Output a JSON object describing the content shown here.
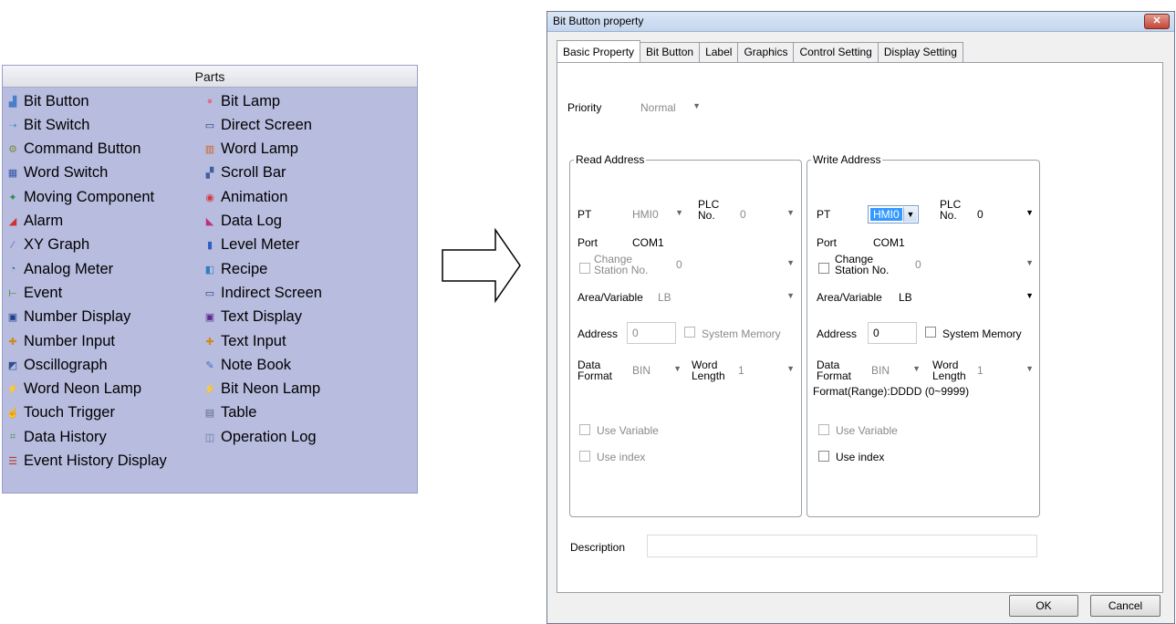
{
  "parts": {
    "header": "Parts",
    "left_items": [
      {
        "label": "Bit Button",
        "icon": "bit-button-icon",
        "glyph": "▟",
        "color": "#4a7fc8"
      },
      {
        "label": "Bit Switch",
        "icon": "bit-switch-icon",
        "glyph": "➝",
        "color": "#3f8fd0"
      },
      {
        "label": "Command Button",
        "icon": "command-button-icon",
        "glyph": "⚙",
        "color": "#7a8a3a"
      },
      {
        "label": "Word Switch",
        "icon": "word-switch-icon",
        "glyph": "▦",
        "color": "#3355aa"
      },
      {
        "label": "Moving Component",
        "icon": "moving-component-icon",
        "glyph": "✦",
        "color": "#2e8b57"
      },
      {
        "label": "Alarm",
        "icon": "alarm-icon",
        "glyph": "◢",
        "color": "#d03030"
      },
      {
        "label": "XY Graph",
        "icon": "xy-graph-icon",
        "glyph": "⁄",
        "color": "#6a5acd"
      },
      {
        "label": "Analog Meter",
        "icon": "analog-meter-icon",
        "glyph": "◔",
        "color": "#2f6fa8"
      },
      {
        "label": "Event",
        "icon": "event-icon",
        "glyph": "⊢",
        "color": "#2a8a2a"
      },
      {
        "label": "Number Display",
        "icon": "number-display-icon",
        "glyph": "▣",
        "color": "#1f3f8f"
      },
      {
        "label": "Number Input",
        "icon": "number-input-icon",
        "glyph": "✚",
        "color": "#d08a1a"
      },
      {
        "label": "Oscillograph",
        "icon": "oscillograph-icon",
        "glyph": "◩",
        "color": "#2b4f8f"
      },
      {
        "label": "Word Neon Lamp",
        "icon": "word-neon-lamp-icon",
        "glyph": "⚡",
        "color": "#7a4fc8"
      },
      {
        "label": "Touch Trigger",
        "icon": "touch-trigger-icon",
        "glyph": "☝",
        "color": "#3a7fd0"
      },
      {
        "label": "Data History",
        "icon": "data-history-icon",
        "glyph": "⌗",
        "color": "#4f8f4f"
      },
      {
        "label": "Event History Display",
        "icon": "event-history-display-icon",
        "glyph": "☰",
        "color": "#b04030"
      }
    ],
    "right_items": [
      {
        "label": "Bit Lamp",
        "icon": "bit-lamp-icon",
        "glyph": "●",
        "color": "#e07090"
      },
      {
        "label": "Direct Screen",
        "icon": "direct-screen-icon",
        "glyph": "▭",
        "color": "#1f3f7f"
      },
      {
        "label": "Word Lamp",
        "icon": "word-lamp-icon",
        "glyph": "▥",
        "color": "#d06020"
      },
      {
        "label": "Scroll Bar",
        "icon": "scroll-bar-icon",
        "glyph": "▞",
        "color": "#3f5f9f"
      },
      {
        "label": "Animation",
        "icon": "animation-icon",
        "glyph": "◉",
        "color": "#d03a3a"
      },
      {
        "label": "Data Log",
        "icon": "data-log-icon",
        "glyph": "◣",
        "color": "#c0307a"
      },
      {
        "label": "Level Meter",
        "icon": "level-meter-icon",
        "glyph": "▮",
        "color": "#3060c0"
      },
      {
        "label": "Recipe",
        "icon": "recipe-icon",
        "glyph": "◧",
        "color": "#2f7fbf"
      },
      {
        "label": "Indirect Screen",
        "icon": "indirect-screen-icon",
        "glyph": "▭",
        "color": "#1f3f7f"
      },
      {
        "label": "Text Display",
        "icon": "text-display-icon",
        "glyph": "▣",
        "color": "#5a2a8f"
      },
      {
        "label": "Text Input",
        "icon": "text-input-icon",
        "glyph": "✚",
        "color": "#d08a1a"
      },
      {
        "label": "Note Book",
        "icon": "note-book-icon",
        "glyph": "✎",
        "color": "#3a6fbf"
      },
      {
        "label": "Bit Neon Lamp",
        "icon": "bit-neon-lamp-icon",
        "glyph": "⚡",
        "color": "#7a4fc8"
      },
      {
        "label": "Table",
        "icon": "table-icon",
        "glyph": "▤",
        "color": "#5a6a8a"
      },
      {
        "label": "Operation Log",
        "icon": "operation-log-icon",
        "glyph": "◫",
        "color": "#5a7aa0"
      }
    ]
  },
  "dialog": {
    "title": "Bit Button property",
    "tabs": [
      "Basic Property",
      "Bit Button",
      "Label",
      "Graphics",
      "Control Setting",
      "Display Setting"
    ],
    "priority_label": "Priority",
    "priority_value": "Normal",
    "read": {
      "title": "Read Address",
      "pt_label": "PT",
      "pt_value": "HMI0",
      "plc_label_1": "PLC",
      "plc_label_2": "No.",
      "plc_value": "0",
      "port_label": "Port",
      "port_value": "COM1",
      "change_label_1": "Change",
      "change_label_2": "Station No.",
      "station_value": "0",
      "area_label": "Area/Variable",
      "area_value": "LB",
      "address_label": "Address",
      "address_value": "0",
      "system_memory_label": "System Memory",
      "data_label_1": "Data",
      "data_label_2": "Format",
      "data_value": "BIN",
      "word_label_1": "Word",
      "word_label_2": "Length",
      "word_value": "1",
      "use_variable_label": "Use Variable",
      "use_index_label": "Use index"
    },
    "write": {
      "title": "Write Address",
      "pt_label": "PT",
      "pt_value": "HMI0",
      "plc_label_1": "PLC",
      "plc_label_2": "No.",
      "plc_value": "0",
      "port_label": "Port",
      "port_value": "COM1",
      "change_label_1": "Change",
      "change_label_2": "Station No.",
      "station_value": "0",
      "area_label": "Area/Variable",
      "area_value": "LB",
      "address_label": "Address",
      "address_value": "0",
      "system_memory_label": "System Memory",
      "data_label_1": "Data",
      "data_label_2": "Format",
      "data_value": "BIN",
      "word_label_1": "Word",
      "word_label_2": "Length",
      "word_value": "1",
      "format_range": "Format(Range):DDDD (0~9999)",
      "use_variable_label": "Use Variable",
      "use_index_label": "Use index"
    },
    "description_label": "Description",
    "description_value": "",
    "ok_label": "OK",
    "cancel_label": "Cancel",
    "close_glyph": "✕"
  }
}
